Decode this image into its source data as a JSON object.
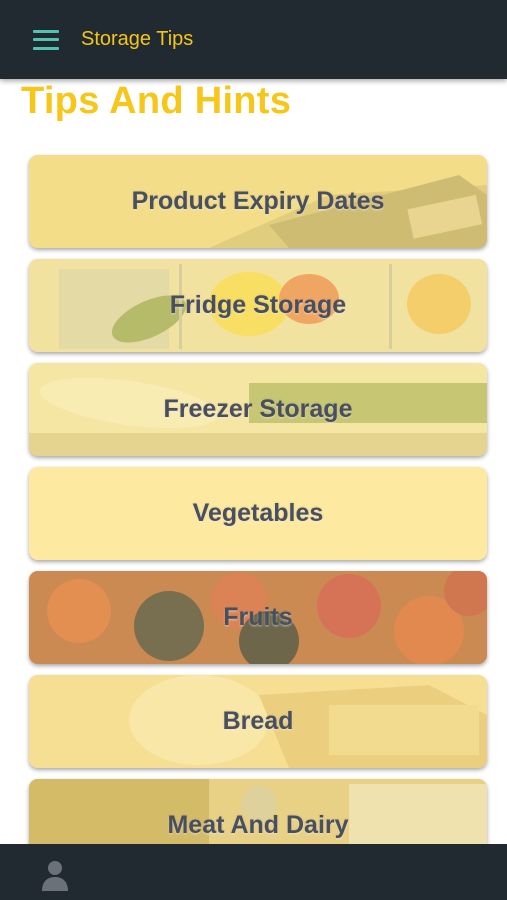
{
  "appbar": {
    "title": "Storage Tips",
    "menu_icon": "hamburger-menu-icon"
  },
  "heading": "Tips And Hints",
  "cards": [
    {
      "label": "Product Expiry Dates",
      "theme": "#e9cf6a"
    },
    {
      "label": "Fridge Storage",
      "theme": "#d8c46a"
    },
    {
      "label": "Freezer Storage",
      "theme": "#e6d38a"
    },
    {
      "label": "Vegetables",
      "theme": "#fde9a0"
    },
    {
      "label": "Fruits",
      "theme": "#c0703a"
    },
    {
      "label": "Bread",
      "theme": "#e7c77a"
    },
    {
      "label": "Meat And Dairy",
      "theme": "#cfb45a"
    }
  ],
  "bottombar": {
    "icon": "user-profile-icon"
  },
  "colors": {
    "appbar_bg": "#202a30",
    "accent": "#f5c518",
    "menu_icon": "#4fc3b4",
    "label_text": "#4a4f5a"
  }
}
